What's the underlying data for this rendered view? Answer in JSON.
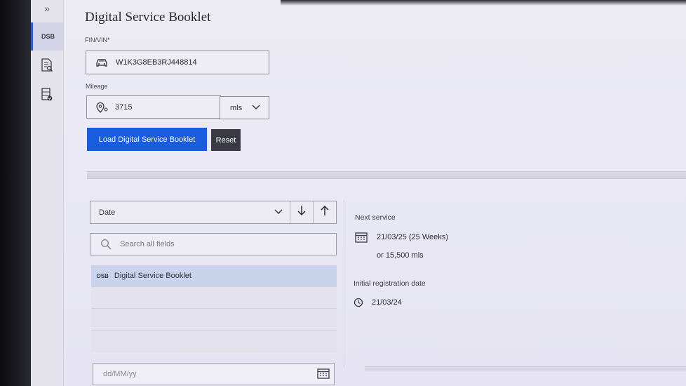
{
  "sidebar": {
    "expand_glyph": "»",
    "items": [
      {
        "label": "DSB",
        "active": true
      },
      {
        "icon": "document-search-icon"
      },
      {
        "icon": "list-check-icon"
      }
    ]
  },
  "page": {
    "title": "Digital Service Booklet"
  },
  "form": {
    "vin_label": "FIN/VIN*",
    "vin_value": "W1K3G8EB3RJ448814",
    "mileage_label": "Mileage",
    "mileage_value": "3715",
    "unit_value": "mls",
    "load_button": "Load Digital Service Booklet",
    "reset_button": "Reset"
  },
  "filter": {
    "sort_value": "Date",
    "search_placeholder": "Search all fields",
    "date_placeholder": "dd/MM/yy"
  },
  "list": {
    "items": [
      {
        "tag": "DSB",
        "label": "Digital Service Booklet",
        "selected": true
      }
    ]
  },
  "details": {
    "next_service_label": "Next service",
    "next_service_date": "21/03/25 (25 Weeks)",
    "next_service_mileage": "or 15,500 mls",
    "registration_label": "Initial registration date",
    "registration_date": "21/03/24"
  },
  "colors": {
    "primary": "#1a5ce0",
    "reset": "#3a3a42",
    "selected_row": "#c9d3ec"
  }
}
